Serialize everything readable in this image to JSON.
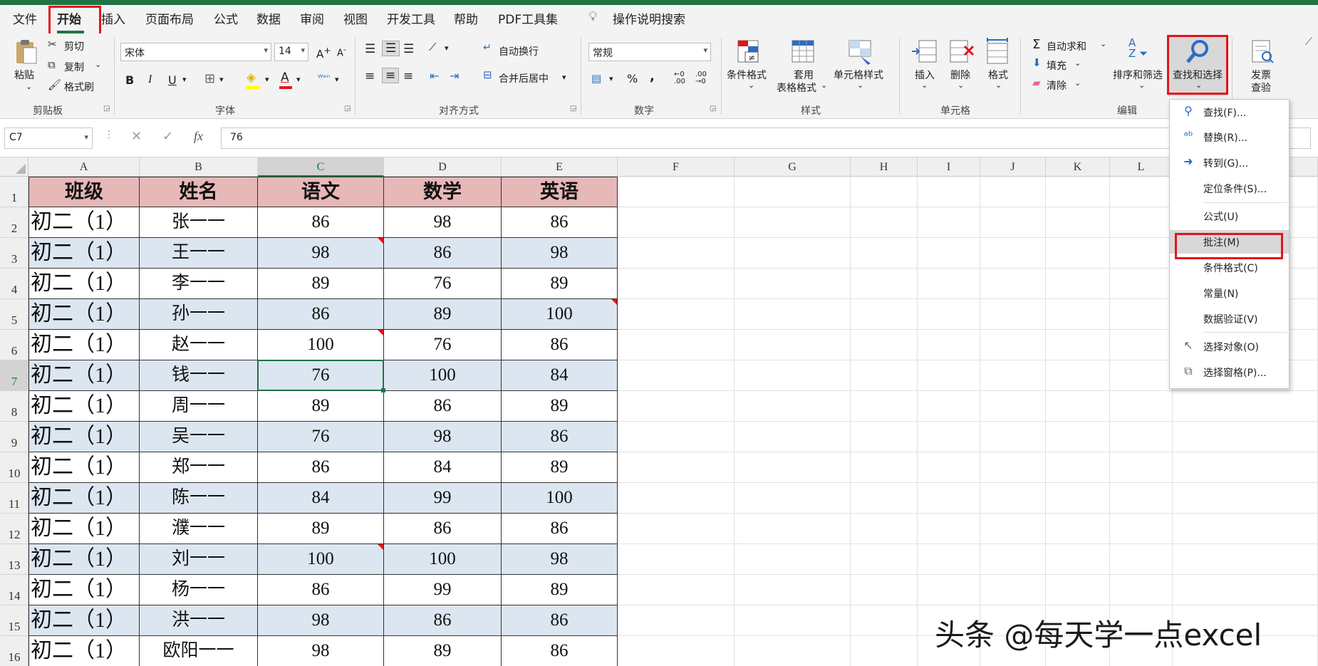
{
  "tabs": [
    "文件",
    "开始",
    "插入",
    "页面布局",
    "公式",
    "数据",
    "审阅",
    "视图",
    "开发工具",
    "帮助",
    "PDF工具集"
  ],
  "tell_me": "操作说明搜索",
  "clipboard": {
    "paste": "粘贴",
    "cut": "剪切",
    "copy": "复制",
    "format_painter": "格式刷",
    "label": "剪贴板"
  },
  "font": {
    "name": "宋体",
    "size": "14",
    "bold": "B",
    "italic": "I",
    "underline": "U",
    "label": "字体"
  },
  "alignment": {
    "wrap": "自动换行",
    "merge": "合并后居中",
    "label": "对齐方式"
  },
  "number": {
    "format": "常规",
    "label": "数字"
  },
  "styles": {
    "conditional": "条件格式",
    "table_format_1": "套用",
    "table_format_2": "表格格式",
    "cell_styles": "单元格样式",
    "label": "样式"
  },
  "cells": {
    "insert": "插入",
    "delete": "删除",
    "format": "格式",
    "label": "单元格"
  },
  "editing": {
    "autosum": "自动求和",
    "fill": "填充",
    "clear": "清除",
    "sort_filter": "排序和筛选",
    "find_select": "查找和选择",
    "label": "编辑"
  },
  "invoice": {
    "line1": "发票",
    "line2": "查验"
  },
  "formula_bar": {
    "name_box": "C7",
    "value": "76"
  },
  "columns": [
    "A",
    "B",
    "C",
    "D",
    "E",
    "F",
    "G",
    "H",
    "I",
    "J",
    "K",
    "L"
  ],
  "rows": [
    "1",
    "2",
    "3",
    "4",
    "5",
    "6",
    "7",
    "8",
    "9",
    "10",
    "11",
    "12",
    "13",
    "14",
    "15",
    "16"
  ],
  "table": {
    "headers": [
      "班级",
      "姓名",
      "语文",
      "数学",
      "英语"
    ],
    "rows": [
      [
        "初二（1）",
        "张一一",
        "86",
        "98",
        "86"
      ],
      [
        "初二（1）",
        "王一一",
        "98",
        "86",
        "98"
      ],
      [
        "初二（1）",
        "李一一",
        "89",
        "76",
        "89"
      ],
      [
        "初二（1）",
        "孙一一",
        "86",
        "89",
        "100"
      ],
      [
        "初二（1）",
        "赵一一",
        "100",
        "76",
        "86"
      ],
      [
        "初二（1）",
        "钱一一",
        "76",
        "100",
        "84"
      ],
      [
        "初二（1）",
        "周一一",
        "89",
        "86",
        "89"
      ],
      [
        "初二（1）",
        "吴一一",
        "76",
        "98",
        "86"
      ],
      [
        "初二（1）",
        "郑一一",
        "86",
        "84",
        "89"
      ],
      [
        "初二（1）",
        "陈一一",
        "84",
        "99",
        "100"
      ],
      [
        "初二（1）",
        "濮一一",
        "89",
        "86",
        "86"
      ],
      [
        "初二（1）",
        "刘一一",
        "100",
        "100",
        "98"
      ],
      [
        "初二（1）",
        "杨一一",
        "86",
        "99",
        "89"
      ],
      [
        "初二（1）",
        "洪一一",
        "98",
        "86",
        "86"
      ],
      [
        "初二（1）",
        "欧阳一一",
        "98",
        "89",
        "86"
      ]
    ]
  },
  "menu": {
    "items": [
      "查找(F)...",
      "替换(R)...",
      "转到(G)...",
      "定位条件(S)...",
      "公式(U)",
      "批注(M)",
      "条件格式(C)",
      "常量(N)",
      "数据验证(V)",
      "选择对象(O)",
      "选择窗格(P)..."
    ],
    "highlighted": "批注(M)"
  },
  "watermark": "头条 @每天学一点excel",
  "colors": {
    "accent": "#217346",
    "header_fill": "#e6b8b7",
    "band_fill": "#dce6f1",
    "highlight_box": "#e3141c"
  }
}
